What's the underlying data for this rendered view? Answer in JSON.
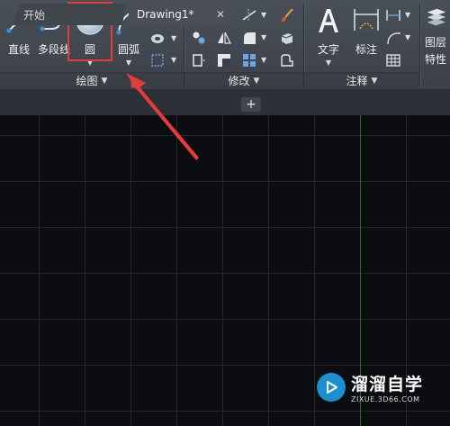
{
  "ribbon": {
    "draw_panel": {
      "title": "绘图",
      "line_label": "直线",
      "polyline_label": "多段线",
      "circle_label": "圆",
      "arc_label": "圆弧"
    },
    "modify_panel": {
      "title": "修改"
    },
    "annotation_panel": {
      "title": "注释",
      "text_label": "文字",
      "dimension_label": "标注"
    },
    "layer_props_label": "图层\n特性",
    "layer_label_1": "图层",
    "layer_label_2": "特性"
  },
  "tabs": [
    {
      "label": "开始"
    },
    {
      "label": "Drawing1*"
    }
  ],
  "tab_close": "✕",
  "tab_add": "+",
  "watermark": {
    "main": "溜溜自学",
    "sub": "ZIXUE.3D66.COM"
  },
  "colors": {
    "highlight": "#e53b3b",
    "arrow": "#e53b3b",
    "y_axis": "#2f6a2a",
    "watermark_logo": "#1b8fd0"
  }
}
